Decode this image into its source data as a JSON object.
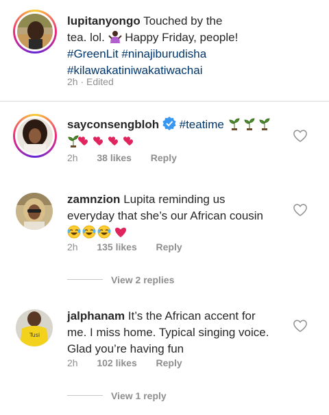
{
  "caption": {
    "username": "lupitanyongo",
    "text_line1": "Touched by the",
    "text_line2a": "tea. lol.",
    "text_line2b": "Happy Friday, people!",
    "hashtags_line3": "#GreenLit #ninajiburudisha",
    "hashtags_line4": "#kilawakatiniwakatiwachai",
    "time": "2h",
    "edited": "Edited",
    "separator": "·"
  },
  "comments": [
    {
      "username": "sayconsengbloh",
      "verified": true,
      "hashtag": "#teatime",
      "time": "2h",
      "likes": "38 likes",
      "reply": "Reply"
    },
    {
      "username": "zamnzion",
      "text_line1": "Lupita reminding us",
      "text_line2": "everyday that she’s our African cousin",
      "time": "2h",
      "likes": "135 likes",
      "reply": "Reply",
      "view_replies": "View 2 replies"
    },
    {
      "username": "jalphanam",
      "text_line1": "It’s the African accent for",
      "text_line2": "me. I miss home. Typical singing voice.",
      "text_line3": "Glad you’re having fun",
      "time": "2h",
      "likes": "102 likes",
      "reply": "Reply",
      "view_replies": "View 1 reply"
    }
  ],
  "icons": {
    "heart": "heart-outline-icon",
    "verified": "verified-badge-icon"
  },
  "colors": {
    "hashtag": "#003569",
    "meta": "#8e8e8e",
    "verified": "#3897f0",
    "heart_emoji": "#e0245e"
  }
}
